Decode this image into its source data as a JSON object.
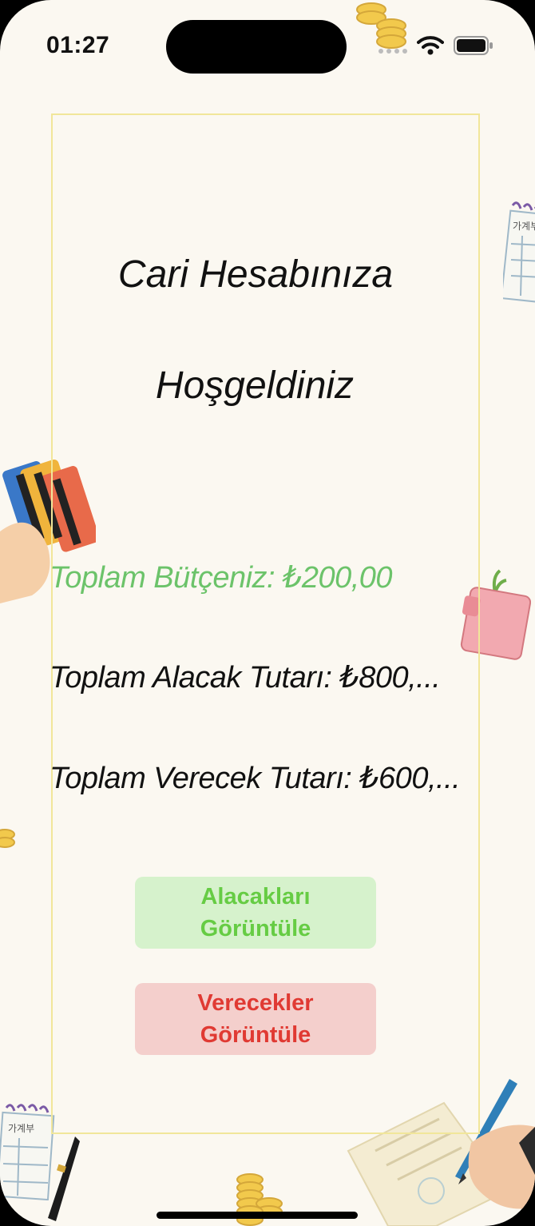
{
  "status_bar": {
    "time": "01:27",
    "icons": [
      "cellular-signal-icon",
      "wifi-icon",
      "battery-icon"
    ]
  },
  "welcome": {
    "line1": "Cari Hesabınıza",
    "line2": "Hoşgeldiniz"
  },
  "summary": {
    "budget": "Toplam Bütçeniz: ₺200,00",
    "receivable": "Toplam Alacak Tutarı: ₺800,...",
    "payable": "Toplam Verecek Tutarı: ₺600,..."
  },
  "buttons": {
    "receivables": {
      "line1": "Alacakları",
      "line2": "Görüntüle"
    },
    "payables": {
      "line1": "Verecekler",
      "line2": "Görüntüle"
    }
  },
  "decorations": {
    "items": [
      "coin-stack-icon",
      "ledger-notebook-icon",
      "credit-cards-hand-icon",
      "wallet-icon",
      "coin-icon",
      "pen-icon",
      "signing-hand-icon"
    ],
    "ledger_text": "가계부"
  },
  "colors": {
    "background": "#fbf8f1",
    "frame_border": "#f1e69a",
    "budget_text": "#6cc36a",
    "receivables_button_bg": "#d6f2cc",
    "receivables_button_text": "#66cc44",
    "payables_button_bg": "#f4cfcc",
    "payables_button_text": "#e03a33"
  }
}
